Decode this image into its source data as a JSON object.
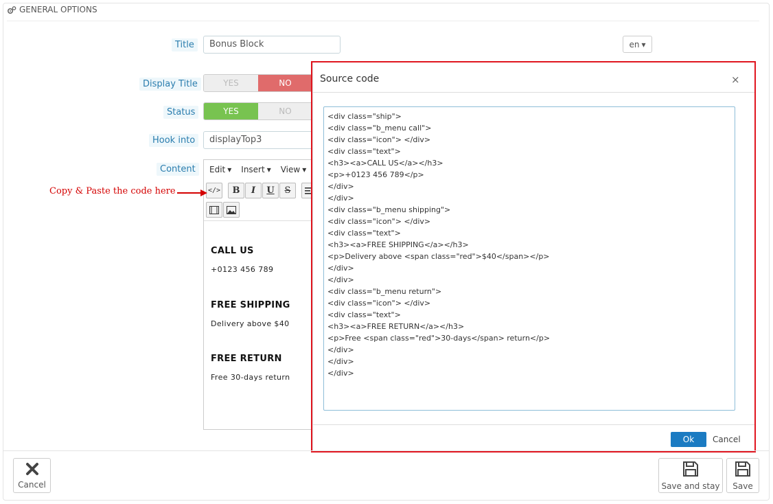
{
  "panel": {
    "heading": "General options"
  },
  "form": {
    "title_label": "Title",
    "title_value": "Bonus Block",
    "lang": "en",
    "display_title_label": "Display Title",
    "display_title_yes": "YES",
    "display_title_no": "NO",
    "display_title_value": "NO",
    "status_label": "Status",
    "status_yes": "YES",
    "status_no": "NO",
    "status_value": "YES",
    "hook_label": "Hook into",
    "hook_value": "displayTop3",
    "content_label": "Content"
  },
  "editor": {
    "menu": [
      "Edit",
      "Insert",
      "View"
    ],
    "toolbar_icons": [
      "source-code-icon",
      "bold-icon",
      "italic-icon",
      "underline-icon",
      "strikethrough-icon",
      "align-left-icon",
      "media-icon",
      "image-icon"
    ],
    "blocks": [
      {
        "heading": "CALL US",
        "text": "+0123 456 789"
      },
      {
        "heading": "FREE SHIPPING",
        "text": "Delivery above $40"
      },
      {
        "heading": "FREE RETURN",
        "text": "Free 30-days return"
      }
    ]
  },
  "annotation": {
    "note": "Copy & Paste the code here"
  },
  "modal": {
    "title": "Source code",
    "close": "×",
    "code_lines": [
      "<div class=\"ship\">",
      "<div class=\"b_menu call\">",
      "<div class=\"icon\"> </div>",
      "<div class=\"text\">",
      "<h3><a>CALL US</a></h3>",
      "<p>+0123 456 789</p>",
      "</div>",
      "</div>",
      "<div class=\"b_menu shipping\">",
      "<div class=\"icon\"> </div>",
      "<div class=\"text\">",
      "<h3><a>FREE SHIPPING</a></h3>",
      "<p>Delivery above <span class=\"red\">$40</span></p>",
      "</div>",
      "</div>",
      "<div class=\"b_menu return\">",
      "<div class=\"icon\"> </div>",
      "<div class=\"text\">",
      "<h3><a>FREE RETURN</a></h3>",
      "<p>Free <span class=\"red\">30-days</span> return</p>",
      "</div>",
      "</div>",
      "</div>"
    ],
    "ok_label": "Ok",
    "cancel_label": "Cancel"
  },
  "footer": {
    "cancel_label": "Cancel",
    "save_stay_label": "Save and stay",
    "save_label": "Save"
  },
  "colors": {
    "label_text": "#2a7dae",
    "no_active": "#e06b6b",
    "yes_active": "#78c350",
    "modal_outline": "#e0141e",
    "ok_button": "#1b7bc2",
    "annotation": "#d40000"
  }
}
